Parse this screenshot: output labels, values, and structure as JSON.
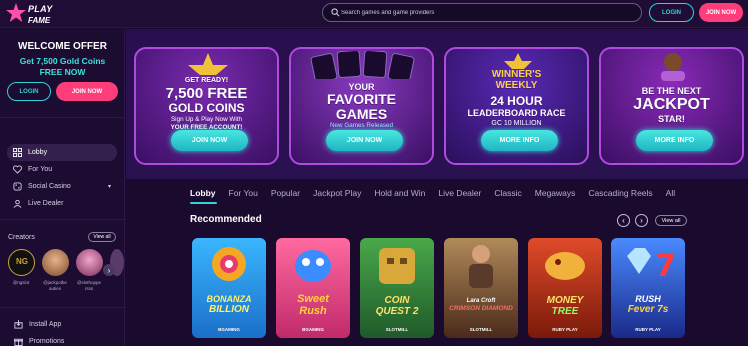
{
  "header": {
    "logo_text": "PLAY",
    "logo_sub": "FAME",
    "search_placeholder": "Search games and game providers",
    "login_label": "LOGIN",
    "join_label": "JOIN NOW"
  },
  "sidebar": {
    "welcome_title": "WELCOME OFFER",
    "welcome_offer_line1": "Get 7,500 Gold Coins",
    "welcome_offer_line2": "FREE NOW",
    "login_label": "LOGIN",
    "join_label": "JOIN NOW",
    "nav": [
      {
        "label": "Lobby",
        "icon": "lobby-icon",
        "active": true
      },
      {
        "label": "For You",
        "icon": "heart-icon",
        "active": false
      },
      {
        "label": "Social Casino",
        "icon": "social-casino-icon",
        "active": false
      },
      {
        "label": "Live Dealer",
        "icon": "live-dealer-icon",
        "active": false
      }
    ],
    "creators_label": "Creators",
    "creators_viewall": "View all",
    "creators": [
      {
        "name": "@ngslot"
      },
      {
        "name": "@jackpotbe auties"
      },
      {
        "name": "@slothoppe rsss"
      },
      {
        "name": ""
      }
    ],
    "bottom": [
      {
        "label": "Install App",
        "icon": "install-app-icon"
      },
      {
        "label": "Promotions",
        "icon": "promotions-icon"
      }
    ]
  },
  "banners": [
    {
      "line1": "GET READY!",
      "line2": "7,500 FREE",
      "line3": "GOLD COINS",
      "sub1": "Sign Up & Play Now With",
      "sub2": "YOUR FREE ACCOUNT!",
      "cta": "JOIN NOW"
    },
    {
      "line1": "YOUR",
      "line2": "FAVORITE",
      "line3": "GAMES",
      "sub1": "New Games Released",
      "sub2": "EVERY WEEK!",
      "cta": "JOIN NOW"
    },
    {
      "line1": "WINNER'S",
      "line2": "WEEKLY",
      "line3": "24 HOUR",
      "line4": "LEADERBOARD RACE",
      "sub1": "GC 10 MILLION",
      "cta": "MORE INFO"
    },
    {
      "line1": "BE THE NEXT",
      "line2": "JACKPOT",
      "line3": "STAR!",
      "cta": "MORE INFO"
    }
  ],
  "tabs": [
    "Lobby",
    "For You",
    "Popular",
    "Jackpot Play",
    "Hold and Win",
    "Live Dealer",
    "Classic",
    "Megaways",
    "Cascading Reels",
    "All"
  ],
  "recommended": {
    "title": "Recommended",
    "viewall": "View all",
    "games": [
      {
        "title1": "BONANZA",
        "title2": "BILLION",
        "provider": "BGAMING",
        "bg": "#2ba6ef"
      },
      {
        "title1": "Sweet",
        "title2": "Rush",
        "provider": "BGAMING",
        "bg": "#d63a6c"
      },
      {
        "title1": "COIN",
        "title2": "QUEST 2",
        "provider": "SLOTMILL",
        "bg": "#2e8b3e"
      },
      {
        "title1": "Lara Croft",
        "title2": "CRIMSON DIAMOND",
        "provider": "SLOTMILL",
        "bg": "#7b5a3e"
      },
      {
        "title1": "MONEY",
        "title2": "TREE",
        "provider": "RUBY PLAY",
        "bg": "#c23a1e"
      },
      {
        "title1": "RUSH",
        "title2": "Fever 7s",
        "provider": "RUBY PLAY",
        "bg": "#3b6fd8"
      }
    ]
  },
  "colors": {
    "accent": "#2fd3d8",
    "join": "#ff3d7a",
    "bg": "#1a0b2e"
  }
}
